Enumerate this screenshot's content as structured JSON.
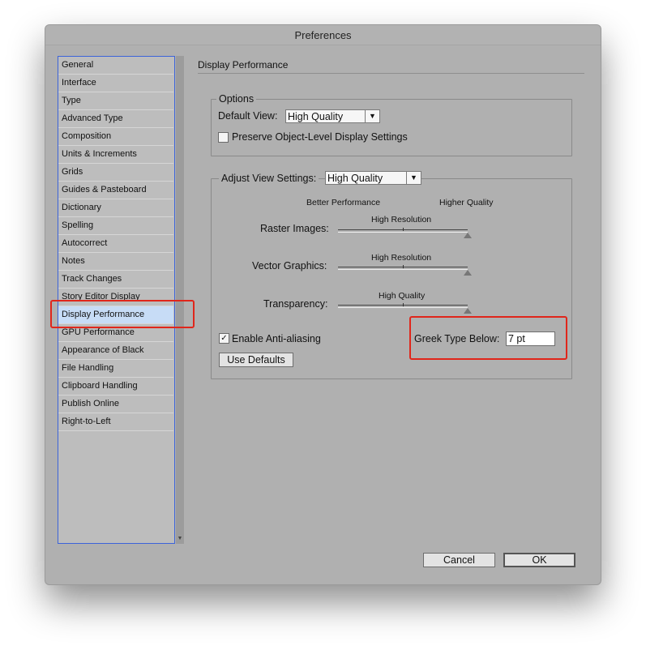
{
  "window": {
    "title": "Preferences"
  },
  "sidebar": {
    "items": [
      {
        "label": "General"
      },
      {
        "label": "Interface"
      },
      {
        "label": "Type"
      },
      {
        "label": "Advanced Type"
      },
      {
        "label": "Composition"
      },
      {
        "label": "Units & Increments"
      },
      {
        "label": "Grids"
      },
      {
        "label": "Guides & Pasteboard"
      },
      {
        "label": "Dictionary"
      },
      {
        "label": "Spelling"
      },
      {
        "label": "Autocorrect"
      },
      {
        "label": "Notes"
      },
      {
        "label": "Track Changes"
      },
      {
        "label": "Story Editor Display"
      },
      {
        "label": "Display Performance"
      },
      {
        "label": "GPU Performance"
      },
      {
        "label": "Appearance of Black"
      },
      {
        "label": "File Handling"
      },
      {
        "label": "Clipboard Handling"
      },
      {
        "label": "Publish Online"
      },
      {
        "label": "Right-to-Left"
      }
    ],
    "selected": "Display Performance"
  },
  "main": {
    "title": "Display Performance",
    "options": {
      "legend": "Options",
      "default_view_label": "Default View:",
      "default_view_value": "High Quality",
      "preserve_label": "Preserve Object-Level Display Settings",
      "preserve_checked": false
    },
    "adjust": {
      "legend": "Adjust View Settings:",
      "view_value": "High Quality",
      "better_performance": "Better Performance",
      "higher_quality": "Higher Quality",
      "sliders": [
        {
          "label": "Raster Images:",
          "value_label": "High Resolution",
          "level": 1.0
        },
        {
          "label": "Vector Graphics:",
          "value_label": "High Resolution",
          "level": 1.0
        },
        {
          "label": "Transparency:",
          "value_label": "High Quality",
          "level": 1.0
        }
      ],
      "antialias_label": "Enable Anti-aliasing",
      "antialias_checked": true,
      "greek_label": "Greek Type Below:",
      "greek_value": "7 pt",
      "use_defaults": "Use Defaults"
    }
  },
  "footer": {
    "cancel": "Cancel",
    "ok": "OK"
  },
  "colors": {
    "highlight": "#e0261b",
    "selection": "#c7dcf6",
    "sidebar_border": "#3c63d9"
  },
  "icons": {
    "dropdown": "triangle-down-icon",
    "checkmark": "checkmark-icon",
    "scroll": "scroll-down-arrow-icon"
  }
}
